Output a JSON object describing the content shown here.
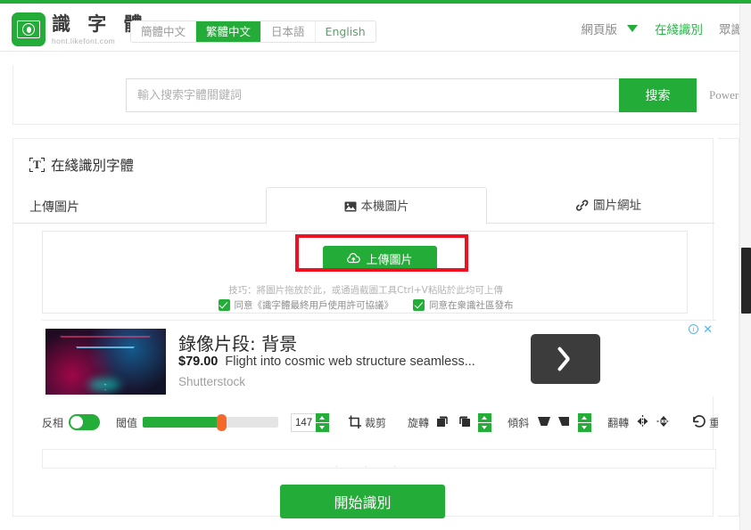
{
  "header": {
    "logo_cn": "識 字 體",
    "logo_url": "hont.likefont.com",
    "languages": [
      {
        "label": "簡體中文",
        "active": false
      },
      {
        "label": "繁體中文",
        "active": true
      },
      {
        "label": "日本語",
        "active": false
      },
      {
        "label": "English",
        "active": false
      }
    ],
    "nav": [
      {
        "label": "網頁版",
        "accent": false
      },
      {
        "label": "在綫識別",
        "accent": true
      },
      {
        "label": "眾識",
        "accent": false
      }
    ],
    "caret_icon": "chevron-down-icon"
  },
  "search": {
    "placeholder": "輸入搜索字體關鍵詞",
    "value": "",
    "button_label": "搜索",
    "powered_by": "Powered b"
  },
  "card": {
    "title": "在綫識別字體",
    "title_icon": "text-recognition-icon",
    "upload_label": "上傳圖片",
    "tabs": [
      {
        "label": "本機圖片",
        "icon": "image-icon",
        "active": true
      },
      {
        "label": "圖片網址",
        "icon": "link-icon",
        "active": false
      }
    ],
    "upload_button": {
      "label": "上傳圖片",
      "icon": "cloud-upload-icon",
      "highlight_color": "#ee1122"
    },
    "tip": "技巧：將圖片拖放於此，或通過截圖工具Ctrl+V粘貼於此均可上傳",
    "agreements": [
      {
        "label": "同意《識字體最終用戶使用許可協議》",
        "checked": true
      },
      {
        "label": "同意在衆識社區發布",
        "checked": true
      }
    ],
    "cta_label": "開始識別"
  },
  "ad": {
    "title": "錄像片段: 背景",
    "price": "$79.00",
    "description": "Flight into cosmic web structure seamless...",
    "brand": "Shutterstock",
    "arrow_icon": "chevron-right-icon",
    "info_icon": "adchoices-info-icon",
    "close_icon": "close-icon"
  },
  "toolbar": {
    "invert_label": "反相",
    "invert_on": true,
    "threshold_label": "閾值",
    "threshold_value": "147",
    "threshold_percent": 58,
    "crop_label": "裁剪",
    "crop_icon": "crop-icon",
    "rotate_label": "旋轉",
    "rotate_left_icon": "rotate-left-icon",
    "rotate_right_icon": "rotate-right-icon",
    "skew_label": "傾斜",
    "skew_left_icon": "skew-left-icon",
    "skew_right_icon": "skew-right-icon",
    "flip_label": "翻轉",
    "flip_h_icon": "flip-horizontal-icon",
    "flip_v_icon": "flip-vertical-icon",
    "reset_label": "重置",
    "reset_icon": "undo-icon"
  },
  "colors": {
    "brand_green": "#23ac38",
    "slider_knob_orange": "#f4682a",
    "highlight_red": "#ee1122",
    "ad_link_blue": "#5ab4e8"
  }
}
